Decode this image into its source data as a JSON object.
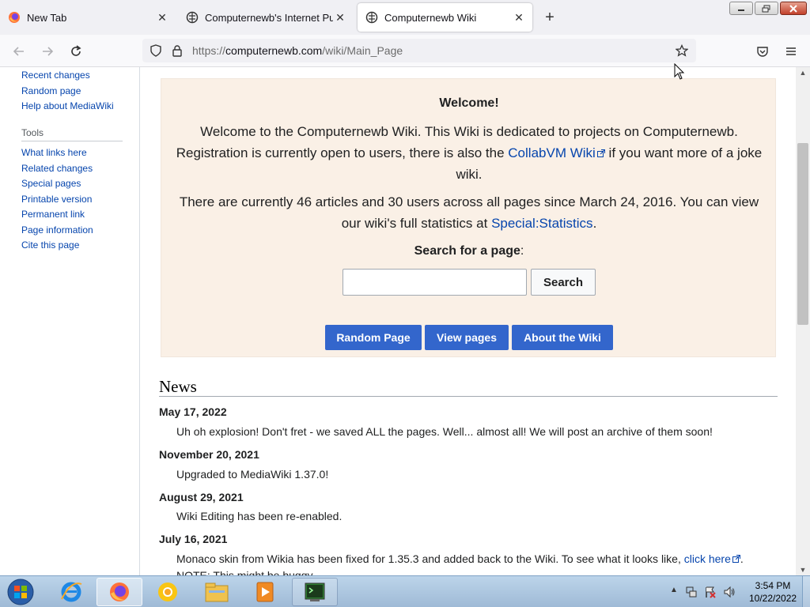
{
  "browser": {
    "tabs": [
      {
        "title": "New Tab",
        "icon": "firefox-icon",
        "active": false
      },
      {
        "title": "Computernewb's Internet Pub",
        "icon": "wiki-puzzle-icon",
        "active": false
      },
      {
        "title": "Computernewb Wiki",
        "icon": "wiki-puzzle-icon",
        "active": true
      }
    ],
    "url": {
      "protocol": "https://",
      "domain": "computernewb.com",
      "path": "/wiki/Main_Page"
    }
  },
  "sidebar": {
    "nav_links": [
      "Recent changes",
      "Random page",
      "Help about MediaWiki"
    ],
    "tools_heading": "Tools",
    "tools_links": [
      "What links here",
      "Related changes",
      "Special pages",
      "Printable version",
      "Permanent link",
      "Page information",
      "Cite this page"
    ]
  },
  "welcome": {
    "title": "Welcome!",
    "para1_line1": "Welcome to the Computernewb Wiki. This Wiki is dedicated to projects on Computernewb.",
    "para1_line2_before": "Registration is currently open to users, there is also the ",
    "para1_link": "CollabVM Wiki",
    "para1_line2_after": " if you want more of a joke",
    "para1_line3": "wiki.",
    "para2_line1": "There are currently 46 articles and 30 users across all pages since March 24, 2016. You can view",
    "para2_line2_before": "our wiki's full statistics at ",
    "para2_link": "Special:Statistics",
    "para2_line2_after": ".",
    "search_label": "Search for a page",
    "search_label_colon": ":",
    "search_value": "",
    "search_button": "Search",
    "buttons": [
      "Random Page",
      "View pages",
      "About the Wiki"
    ]
  },
  "news": {
    "heading": "News",
    "items": [
      {
        "date": "May 17, 2022",
        "text": "Uh oh explosion! Don't fret - we saved ALL the pages. Well... almost all! We will post an archive of them soon!"
      },
      {
        "date": "November 20, 2021",
        "text": "Upgraded to MediaWiki 1.37.0!"
      },
      {
        "date": "August 29, 2021",
        "text": "Wiki Editing has been re-enabled."
      },
      {
        "date": "July 16, 2021",
        "text_before": "Monaco skin from Wikia has been fixed for 1.35.3 and added back to the Wiki. To see what it looks like, ",
        "link": "click here",
        "text_after": ".",
        "note": "NOTE: This might be buggy."
      }
    ]
  },
  "taskbar": {
    "items": [
      "internet-explorer-icon",
      "firefox-icon",
      "chrome-icon",
      "file-explorer-icon",
      "media-player-icon",
      "terminal-icon"
    ],
    "clock_time": "3:54 PM",
    "clock_date": "10/22/2022"
  },
  "colors": {
    "link": "#0645ad",
    "welcome_bg": "#faf0e6",
    "button_blue": "#3366cc"
  }
}
